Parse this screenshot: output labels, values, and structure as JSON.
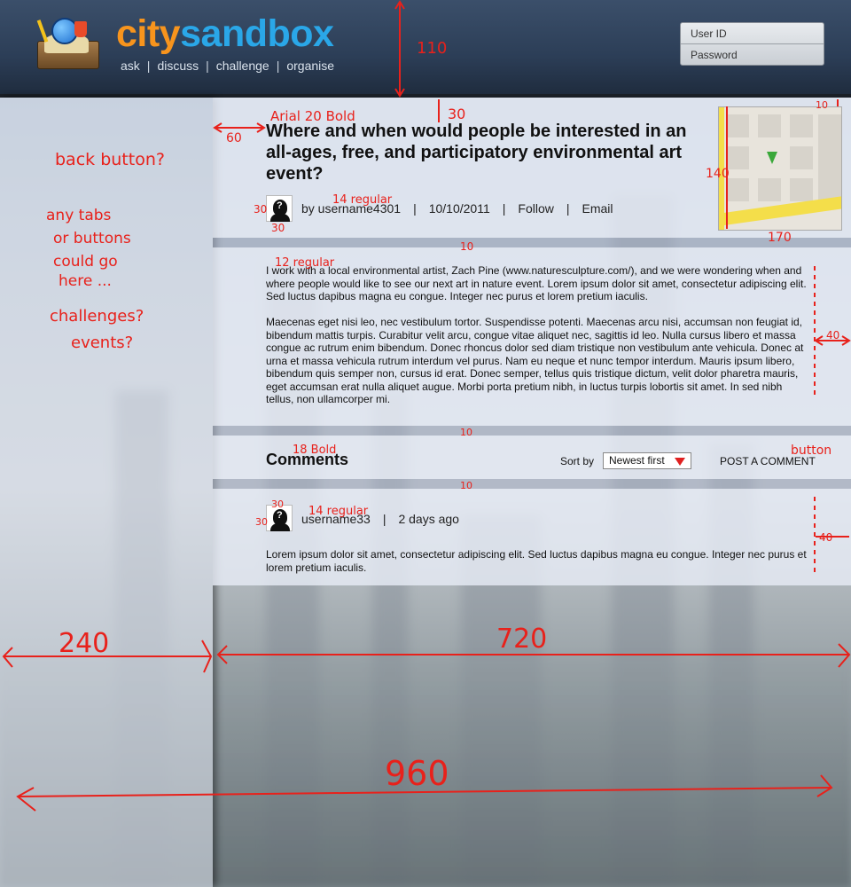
{
  "header": {
    "brand_part1": "city",
    "brand_part2": "sandbox",
    "nav": [
      "ask",
      "discuss",
      "challenge",
      "organise"
    ],
    "nav_separator": "|",
    "login_userid_placeholder": "User ID",
    "login_password_placeholder": "Password"
  },
  "question": {
    "title": "Where and when would people be interested in an all-ages, free, and participatory environmental art event?",
    "author": "by username4301",
    "date": "10/10/2011",
    "follow_label": "Follow",
    "email_label": "Email",
    "separator": "|"
  },
  "body": {
    "paragraphs": [
      " I work with a local environmental artist, Zach Pine (www.naturesculpture.com/), and we were wondering when and where people would like to see our next art in nature event. Lorem ipsum dolor sit amet, consectetur adipiscing elit. Sed luctus dapibus magna eu congue. Integer nec purus et lorem pretium iaculis.",
      "Maecenas eget nisi leo, nec vestibulum tortor. Suspendisse potenti. Maecenas arcu nisi, accumsan non feugiat id, bibendum mattis turpis. Curabitur velit arcu, congue vitae aliquet nec, sagittis id leo. Nulla cursus libero et massa congue ac rutrum enim bibendum. Donec rhoncus dolor sed diam tristique non vestibulum ante vehicula. Donec at urna et massa vehicula rutrum interdum vel purus. Nam eu neque et nunc tempor interdum. Mauris ipsum libero, bibendum quis semper non, cursus id erat. Donec semper, tellus quis tristique dictum, velit dolor pharetra mauris, eget accumsan erat nulla aliquet augue. Morbi porta pretium nibh, in luctus turpis lobortis sit amet. In sed nibh tellus, non ullamcorper mi."
    ]
  },
  "comments": {
    "title": "Comments",
    "sort_label": "Sort by",
    "sort_value": "Newest first",
    "post_button": "POST A COMMENT",
    "items": [
      {
        "username": "username33",
        "time": "2 days ago",
        "text": "Lorem ipsum dolor sit amet, consectetur adipiscing elit. Sed luctus dapibus magna eu congue. Integer nec purus et lorem pretium iaculis."
      }
    ]
  },
  "annotations": {
    "back_button": "back button?",
    "tabs_note_1": "any tabs",
    "tabs_note_2": "or buttons",
    "tabs_note_3": "could go",
    "tabs_note_4": "here ...",
    "challenges": "challenges?",
    "events": "events?",
    "font_title": "Arial 20 Bold",
    "font_regular_14": "14 regular",
    "font_regular_12": "12 regular",
    "font_bold_18": "18 Bold",
    "button": "button",
    "dim_110": "110",
    "dim_30": "30",
    "dim_60": "60",
    "dim_10": "10",
    "dim_140": "140",
    "dim_170": "170",
    "dim_40": "40",
    "dim_240": "240",
    "dim_720": "720",
    "dim_960": "960",
    "accent_color": "#e8211b"
  },
  "colors": {
    "brand_city": "#f7941d",
    "brand_sandbox": "#2aa7e8",
    "header_bg": "#2c3e57"
  }
}
